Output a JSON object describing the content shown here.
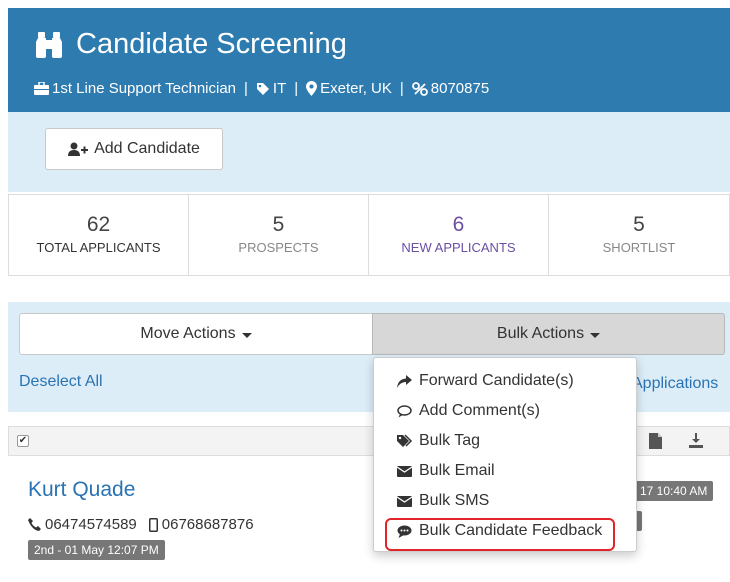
{
  "header": {
    "title": "Candidate Screening",
    "job_title": "1st Line Support Technician",
    "category": "IT",
    "location": "Exeter, UK",
    "reference": "8070875",
    "background_color": "#2e7bb0"
  },
  "toolbar": {
    "add_candidate_label": "Add Candidate"
  },
  "stats": [
    {
      "value": "62",
      "label": "TOTAL APPLICANTS"
    },
    {
      "value": "5",
      "label": "PROSPECTS"
    },
    {
      "value": "6",
      "label": "NEW APPLICANTS"
    },
    {
      "value": "5",
      "label": "SHORTLIST"
    }
  ],
  "actions": {
    "move_label": "Move Actions",
    "bulk_label": "Bulk Actions",
    "deselect_label": "Deselect All",
    "applications_label": "Applications"
  },
  "bulk_menu": {
    "items": [
      {
        "label": "Forward Candidate(s)",
        "icon": "share-icon"
      },
      {
        "label": "Add Comment(s)",
        "icon": "comment-icon"
      },
      {
        "label": "Bulk Tag",
        "icon": "tags-icon"
      },
      {
        "label": "Bulk Email",
        "icon": "envelope-icon"
      },
      {
        "label": "Bulk SMS",
        "icon": "envelope-icon"
      },
      {
        "label": "Bulk Candidate Feedback",
        "icon": "speech-bubble-icon"
      }
    ],
    "highlight_color": "#e0242a"
  },
  "candidate": {
    "name": "Kurt Quade",
    "phone": "06474574589",
    "mobile": "06768687876",
    "date": "2nd - 01 May 12:07 PM",
    "time_badge": "17 10:40 AM"
  }
}
